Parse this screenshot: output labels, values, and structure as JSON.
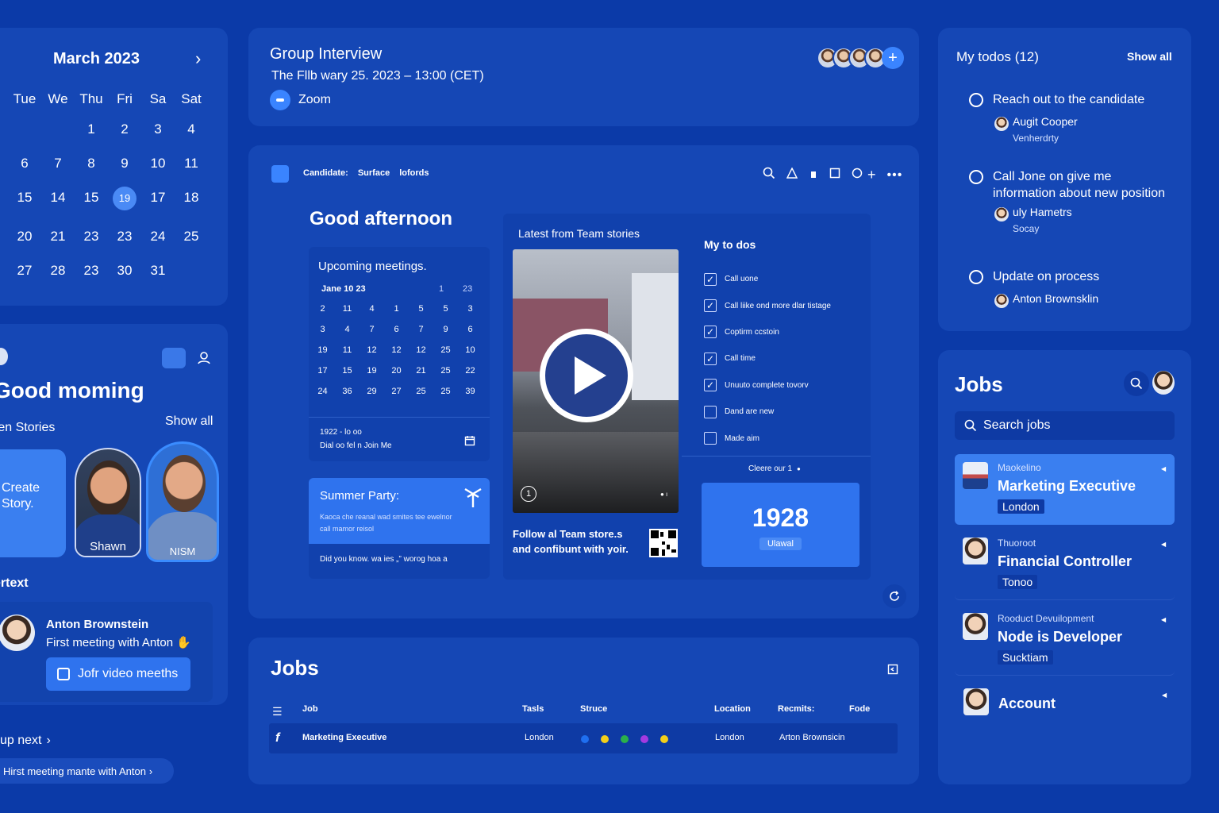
{
  "left_calendar": {
    "month": "March 2023",
    "weekdays": [
      "Tue",
      "We",
      "Thu",
      "Fri",
      "Sa",
      "Sat"
    ],
    "rows": [
      [
        "",
        "",
        "1",
        "2",
        "3",
        "4"
      ],
      [
        "6",
        "7",
        "8",
        "9",
        "10",
        "11"
      ],
      [
        "15",
        "14",
        "15",
        "19",
        "17",
        "18"
      ],
      [
        "20",
        "21",
        "23",
        "23",
        "24",
        "25"
      ],
      [
        "27",
        "28",
        "23",
        "30",
        "31",
        ""
      ]
    ]
  },
  "stories_panel": {
    "greeting": "Good moming",
    "stories_label": "ren Stories",
    "show_all": "Show all",
    "create_story": [
      "Create",
      "Story."
    ],
    "people": [
      "Shawn",
      "NISM"
    ],
    "section_label": "ertext",
    "meeting_person": "Anton Brownstein",
    "meeting_title": "First meeting with Anton",
    "join_button": "Jofr video meeths",
    "up_next": "up next",
    "next_meeting": "Hirst meeting mante with Anton"
  },
  "interview": {
    "title": "Group Interview",
    "datetime": "The Fllb wary 25. 2023 – 13:00 (CET)",
    "platform": "Zoom"
  },
  "dashboard": {
    "tabs": [
      "Candidate:",
      "Surface",
      "lofords"
    ],
    "greeting": "Good afternoon",
    "meetings": {
      "title": "Upcoming meetings.",
      "month_label": "Jane 10 23",
      "header_extra": [
        "1",
        "23"
      ],
      "grid": [
        [
          "2",
          "11",
          "4",
          "1",
          "5",
          "5",
          "3"
        ],
        [
          "3",
          "4",
          "7",
          "6",
          "7",
          "9",
          "6"
        ],
        [
          "19",
          "11",
          "12",
          "12",
          "12",
          "25",
          "10"
        ],
        [
          "17",
          "15",
          "19",
          "20",
          "21",
          "25",
          "22"
        ],
        [
          "24",
          "36",
          "29",
          "27",
          "25",
          "25",
          "39"
        ]
      ],
      "footer_line1": "1922 - lo oo",
      "footer_line2": "Dial oo  fel n Join Me"
    },
    "summer": {
      "title": "Summer Party:",
      "text_line1": "Kaoca che reanal wad smites tee ewelnor",
      "text_line2": "call mamor reisol",
      "footer": "Did you know.  wa ies „” worog hoa a"
    },
    "stories": {
      "title": "Latest from Team stories",
      "video_index": "1",
      "follow_line1": "Follow al Team store.s",
      "follow_line2": "and confibunt with yoir."
    },
    "todos": {
      "title": "My to dos",
      "items": [
        {
          "label": "Call uone",
          "checked": true
        },
        {
          "label": "Call liike ond more dlar tistage",
          "checked": true
        },
        {
          "label": "Coptirm ccstoin",
          "checked": true
        },
        {
          "label": "Call time",
          "checked": true
        },
        {
          "label": "Unuuto complete tovorv",
          "checked": true
        },
        {
          "label": "Dand are new",
          "checked": false
        },
        {
          "label": "Made aim",
          "checked": false
        }
      ],
      "footer": "Cleere our 1"
    },
    "stat": {
      "value": "1928",
      "label": "Ulawal"
    }
  },
  "jobs_table": {
    "title": "Jobs",
    "headers": [
      "Job",
      "Tasls",
      "Struce",
      "Location",
      "Recmits:",
      "Fode"
    ],
    "row": {
      "job": "Marketing Executive",
      "tasks": "London",
      "location": "London",
      "recruiter": "Arton Brownsicin"
    },
    "dot_colors": [
      "#1f6ff0",
      "#f2cf1a",
      "#2bb04a",
      "#a33ae0",
      "#f2cf1a"
    ]
  },
  "my_todos": {
    "title": "My todos (12)",
    "show_all": "Show all",
    "items": [
      {
        "text": "Reach out to the candidate",
        "person": "Augit Cooper",
        "sub": "Venherdrty"
      },
      {
        "text": "Call Jone on give me information about new position",
        "person": "uly Hametrs",
        "sub": "Socay"
      },
      {
        "text": "Update on process",
        "person": "Anton Brownsklin",
        "sub": ""
      }
    ]
  },
  "jobs_sidebar": {
    "title": "Jobs",
    "search_placeholder": "Search jobs",
    "items": [
      {
        "company": "Maokelino",
        "title": "Marketing Executive",
        "location": "London"
      },
      {
        "company": "Thuoroot",
        "title": "Financial Controller",
        "location": "Tonoo"
      },
      {
        "company": "Rooduct Devuilopment",
        "title": "Node is Developer",
        "location": "Sucktiam"
      }
    ],
    "account": "Account"
  }
}
